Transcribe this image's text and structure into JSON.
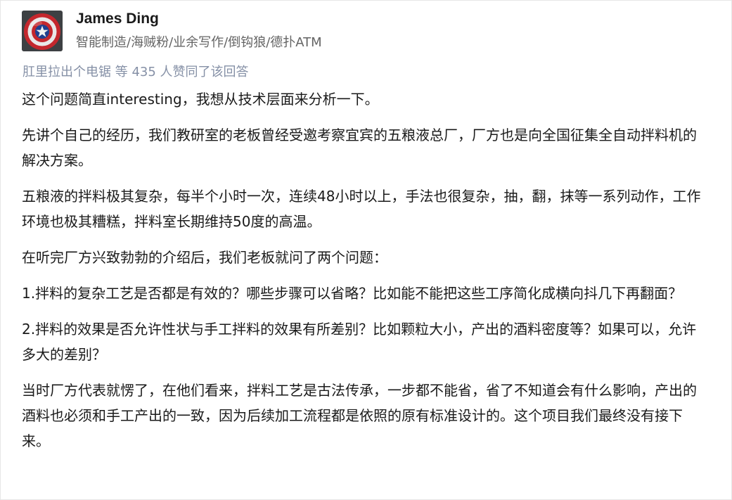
{
  "author": {
    "name": "James Ding",
    "headline": "智能制造/海贼粉/业余写作/倒钩狼/德扑ATM",
    "avatar_icon": "captain-america-shield-icon"
  },
  "voters": {
    "user": "肛里拉出个电锯",
    "separator": " ",
    "summary": "等 435 人赞同了该回答"
  },
  "answer": {
    "paragraphs": [
      "这个问题简直interesting，我想从技术层面来分析一下。",
      "先讲个自己的经历，我们教研室的老板曾经受邀考察宜宾的五粮液总厂，厂方也是向全国征集全自动拌料机的解决方案。",
      "五粮液的拌料极其复杂，每半个小时一次，连续48小时以上，手法也很复杂，抽，翻，抹等一系列动作，工作环境也极其糟糕，拌料室长期维持50度的高温。",
      "在听完厂方兴致勃勃的介绍后，我们老板就问了两个问题：",
      "1.拌料的复杂工艺是否都是有效的？哪些步骤可以省略？比如能不能把这些工序简化成横向抖几下再翻面？",
      "2.拌料的效果是否允许性状与手工拌料的效果有所差别？比如颗粒大小，产出的酒料密度等？如果可以，允许多大的差别？",
      "当时厂方代表就愣了，在他们看来，拌料工艺是古法传承，一步都不能省，省了不知道会有什么影响，产出的酒料也必须和手工产出的一致，因为后续加工流程都是依照的原有标准设计的。这个项目我们最终没有接下来。"
    ]
  },
  "colors": {
    "name": "#1a1a1a",
    "headline": "#646464",
    "voters": "#8590a6",
    "body": "#1a1a1a",
    "shield_red": "#c4272d",
    "shield_blue": "#1f3f8f"
  }
}
